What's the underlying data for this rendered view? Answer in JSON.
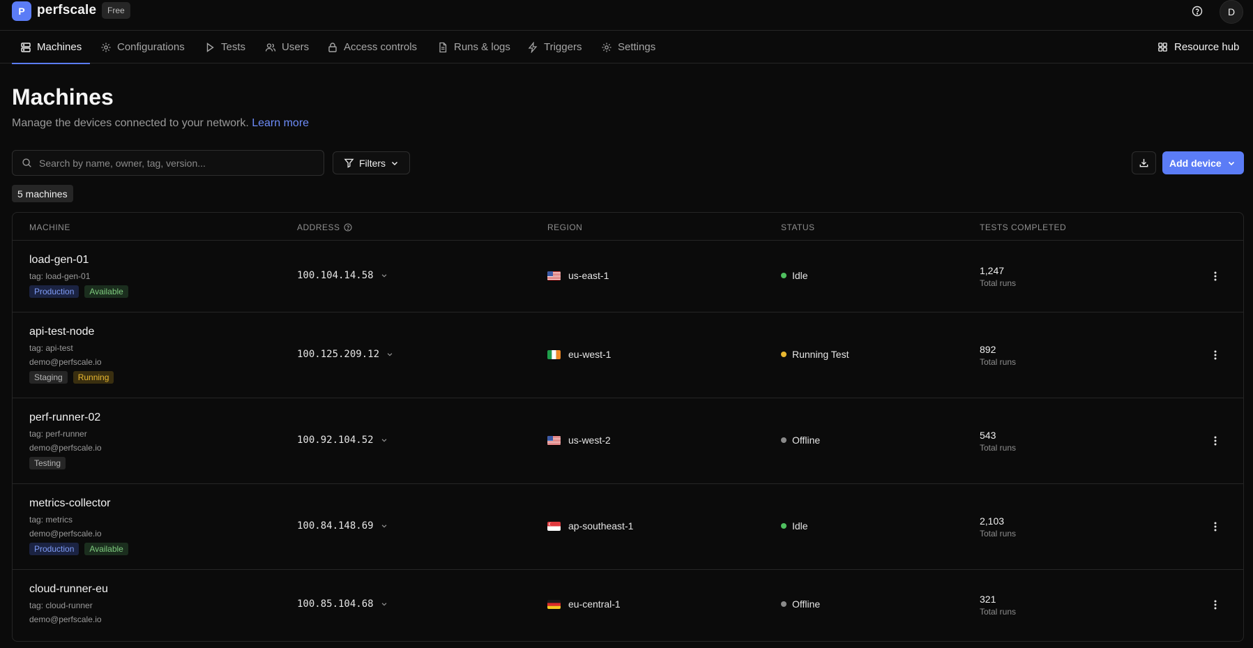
{
  "app": {
    "logo_letter": "P",
    "name": "perfscale",
    "plan": "Free",
    "avatar_initial": "D"
  },
  "nav": {
    "tabs": [
      {
        "label": "Machines",
        "icon": "server-icon",
        "active": true
      },
      {
        "label": "Configurations",
        "icon": "gear-icon",
        "active": false
      },
      {
        "label": "Tests",
        "icon": "play-icon",
        "active": false
      },
      {
        "label": "Users",
        "icon": "users-icon",
        "active": false
      },
      {
        "label": "Access controls",
        "icon": "lock-icon",
        "active": false
      },
      {
        "label": "Runs & logs",
        "icon": "document-icon",
        "active": false
      },
      {
        "label": "Triggers",
        "icon": "lightning-icon",
        "active": false
      },
      {
        "label": "Settings",
        "icon": "gear-icon",
        "active": false
      }
    ],
    "resource_hub": "Resource hub"
  },
  "page": {
    "title": "Machines",
    "description": "Manage the devices connected to your network.",
    "learn_more": "Learn more"
  },
  "toolbar": {
    "search_placeholder": "Search by name, owner, tag, version...",
    "filters_label": "Filters",
    "add_device_label": "Add device",
    "count_label": "5 machines"
  },
  "table": {
    "columns": [
      "MACHINE",
      "ADDRESS",
      "REGION",
      "STATUS",
      "TESTS COMPLETED"
    ],
    "rows": [
      {
        "name": "load-gen-01",
        "tag": "tag: load-gen-01",
        "owner": "",
        "badges": [
          {
            "text": "Production",
            "kind": "prod"
          },
          {
            "text": "Available",
            "kind": "avail"
          }
        ],
        "address": "100.104.14.58",
        "flag": "us",
        "region": "us-east-1",
        "status": "Idle",
        "status_color": "#4fbf5f",
        "tests": "1,247",
        "tests_sub": "Total runs"
      },
      {
        "name": "api-test-node",
        "tag": "tag: api-test",
        "owner": "demo@perfscale.io",
        "badges": [
          {
            "text": "Staging",
            "kind": "neutral"
          },
          {
            "text": "Running",
            "kind": "running"
          }
        ],
        "address": "100.125.209.12",
        "flag": "ie",
        "region": "eu-west-1",
        "status": "Running Test",
        "status_color": "#e8b730",
        "tests": "892",
        "tests_sub": "Total runs"
      },
      {
        "name": "perf-runner-02",
        "tag": "tag: perf-runner",
        "owner": "demo@perfscale.io",
        "badges": [
          {
            "text": "Testing",
            "kind": "neutral"
          }
        ],
        "address": "100.92.104.52",
        "flag": "us",
        "region": "us-west-2",
        "status": "Offline",
        "status_color": "#8a8a8a",
        "tests": "543",
        "tests_sub": "Total runs"
      },
      {
        "name": "metrics-collector",
        "tag": "tag: metrics",
        "owner": "demo@perfscale.io",
        "badges": [
          {
            "text": "Production",
            "kind": "prod"
          },
          {
            "text": "Available",
            "kind": "avail"
          }
        ],
        "address": "100.84.148.69",
        "flag": "sg",
        "region": "ap-southeast-1",
        "status": "Idle",
        "status_color": "#4fbf5f",
        "tests": "2,103",
        "tests_sub": "Total runs"
      },
      {
        "name": "cloud-runner-eu",
        "tag": "tag: cloud-runner",
        "owner": "demo@perfscale.io",
        "badges": [],
        "address": "100.85.104.68",
        "flag": "de",
        "region": "eu-central-1",
        "status": "Offline",
        "status_color": "#8a8a8a",
        "tests": "321",
        "tests_sub": "Total runs"
      }
    ]
  },
  "colors": {
    "accent": "#5b7cf6",
    "background": "#0b0b0b",
    "border": "#262626"
  }
}
